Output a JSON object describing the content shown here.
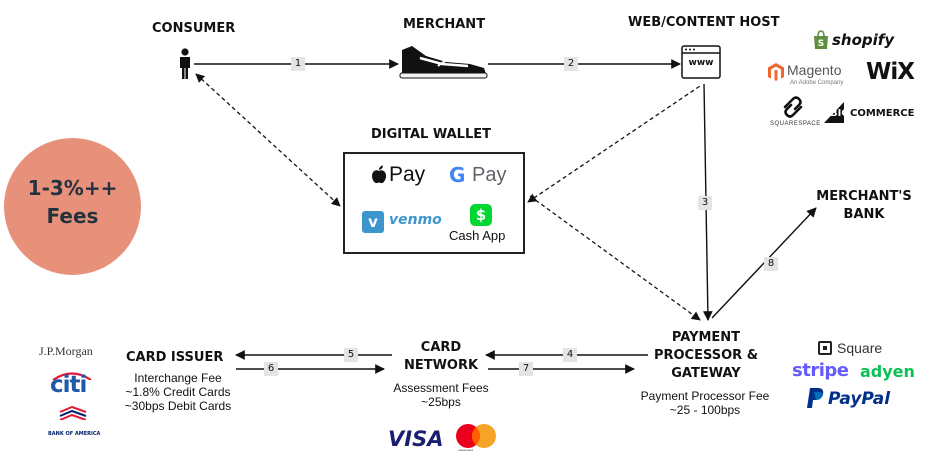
{
  "nodes": {
    "consumer": {
      "title": "CONSUMER"
    },
    "merchant": {
      "title": "MERCHANT"
    },
    "web_host": {
      "title": "WEB/CONTENT HOST",
      "browser_text": "www"
    },
    "digital_wallet": {
      "title": "DIGITAL WALLET"
    },
    "merchants_bank": {
      "title_line1": "MERCHANT'S",
      "title_line2": "BANK"
    },
    "card_issuer": {
      "title": "CARD ISSUER",
      "fee_label": "Interchange Fee",
      "fee_line1": "~1.8% Credit Cards",
      "fee_line2": "~30bps Debit Cards"
    },
    "card_network": {
      "title_line1": "CARD",
      "title_line2": "NETWORK",
      "fee_label": "Assessment Fees",
      "fee_value": "~25bps"
    },
    "payment_processor": {
      "title_line1": "PAYMENT",
      "title_line2": "PROCESSOR &",
      "title_line3": "GATEWAY",
      "fee_label": "Payment Processor Fee",
      "fee_value": "~25 - 100bps"
    }
  },
  "steps": [
    "1",
    "2",
    "3",
    "4",
    "5",
    "6",
    "7",
    "8"
  ],
  "fees_badge": {
    "line1": "1-3%++",
    "line2": "Fees",
    "color": "#e8917a"
  },
  "wallet_brands": {
    "apple_pay": "Pay",
    "google_pay": "Pay",
    "venmo": "venmo",
    "cash_app": "Cash App",
    "cash_app_symbol": "$"
  },
  "host_brands": {
    "shopify": "shopify",
    "magento": "Magento",
    "magento_sub": "An Adobe Company",
    "wix": "WiX",
    "squarespace": "SQUARESPACE",
    "bigcommerce_big": "BIG",
    "bigcommerce_rest": "COMMERCE"
  },
  "issuer_brands": {
    "jpmorgan": "J.P.Morgan",
    "citi": "citi",
    "bank_of_america": "BANK OF AMERICA"
  },
  "network_brands": {
    "visa": "VISA",
    "mastercard": "mastercard"
  },
  "processor_brands": {
    "square": "Square",
    "stripe": "stripe",
    "adyen": "adyen",
    "paypal": "PayPal"
  }
}
